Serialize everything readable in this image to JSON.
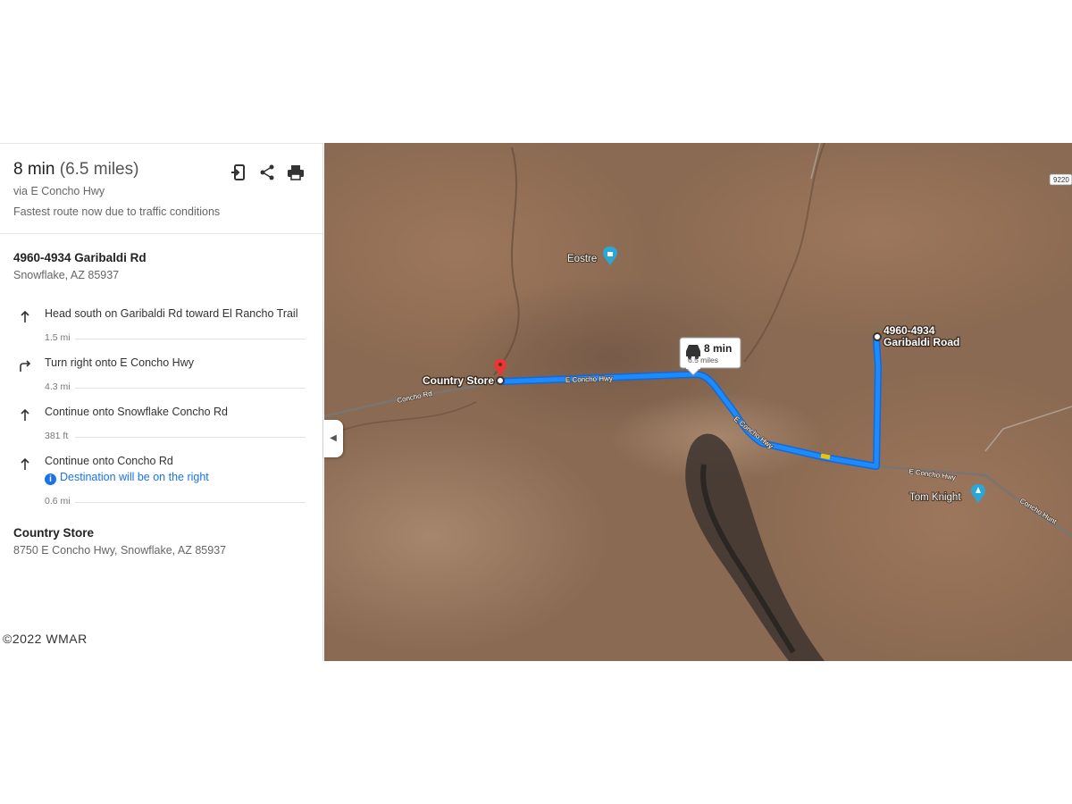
{
  "summary": {
    "duration": "8 min",
    "distance": "(6.5 miles)",
    "via": "via E Concho Hwy",
    "note": "Fastest route now due to traffic conditions"
  },
  "actions": [
    {
      "name": "send-to-phone-icon"
    },
    {
      "name": "share-icon"
    },
    {
      "name": "print-icon"
    }
  ],
  "origin": {
    "name": "4960-4934 Garibaldi Rd",
    "address": "Snowflake, AZ 85937"
  },
  "steps": [
    {
      "icon": "arrow-up-icon",
      "instruction": "Head south on Garibaldi Rd toward El Rancho Trail",
      "distance": "1.5 mi"
    },
    {
      "icon": "turn-right-icon",
      "instruction": "Turn right onto E Concho Hwy",
      "distance": "4.3 mi"
    },
    {
      "icon": "arrow-up-icon",
      "instruction": "Continue onto Snowflake Concho Rd",
      "distance": "381 ft"
    },
    {
      "icon": "arrow-up-icon",
      "instruction": "Continue onto Concho Rd",
      "note": "Destination will be on the right",
      "distance": "0.6 mi"
    }
  ],
  "destination": {
    "name": "Country Store",
    "address": "8750 E Concho Hwy, Snowflake, AZ 85937"
  },
  "watermark": "©2022 WMAR",
  "map": {
    "route_callout": {
      "time": "8 min",
      "distance": "6.5 miles"
    },
    "labels": {
      "start_place": "Country Store",
      "end_place_line1": "4960-4934",
      "end_place_line2": "Garibaldi Road",
      "poi_1": "Eostre",
      "poi_2": "Tom Knight",
      "road_1": "Concho Rd",
      "road_2": "E Concho Hwy",
      "road_3": "E Concho Hwy",
      "road_4": "E Concho Hwy",
      "road_5": "Concho Hunt",
      "road_sign": "9220"
    },
    "colors": {
      "route": "#1a8cff",
      "terrain": "#8a6a52",
      "pin": "#e53935",
      "poi": "#29a8d8"
    }
  }
}
